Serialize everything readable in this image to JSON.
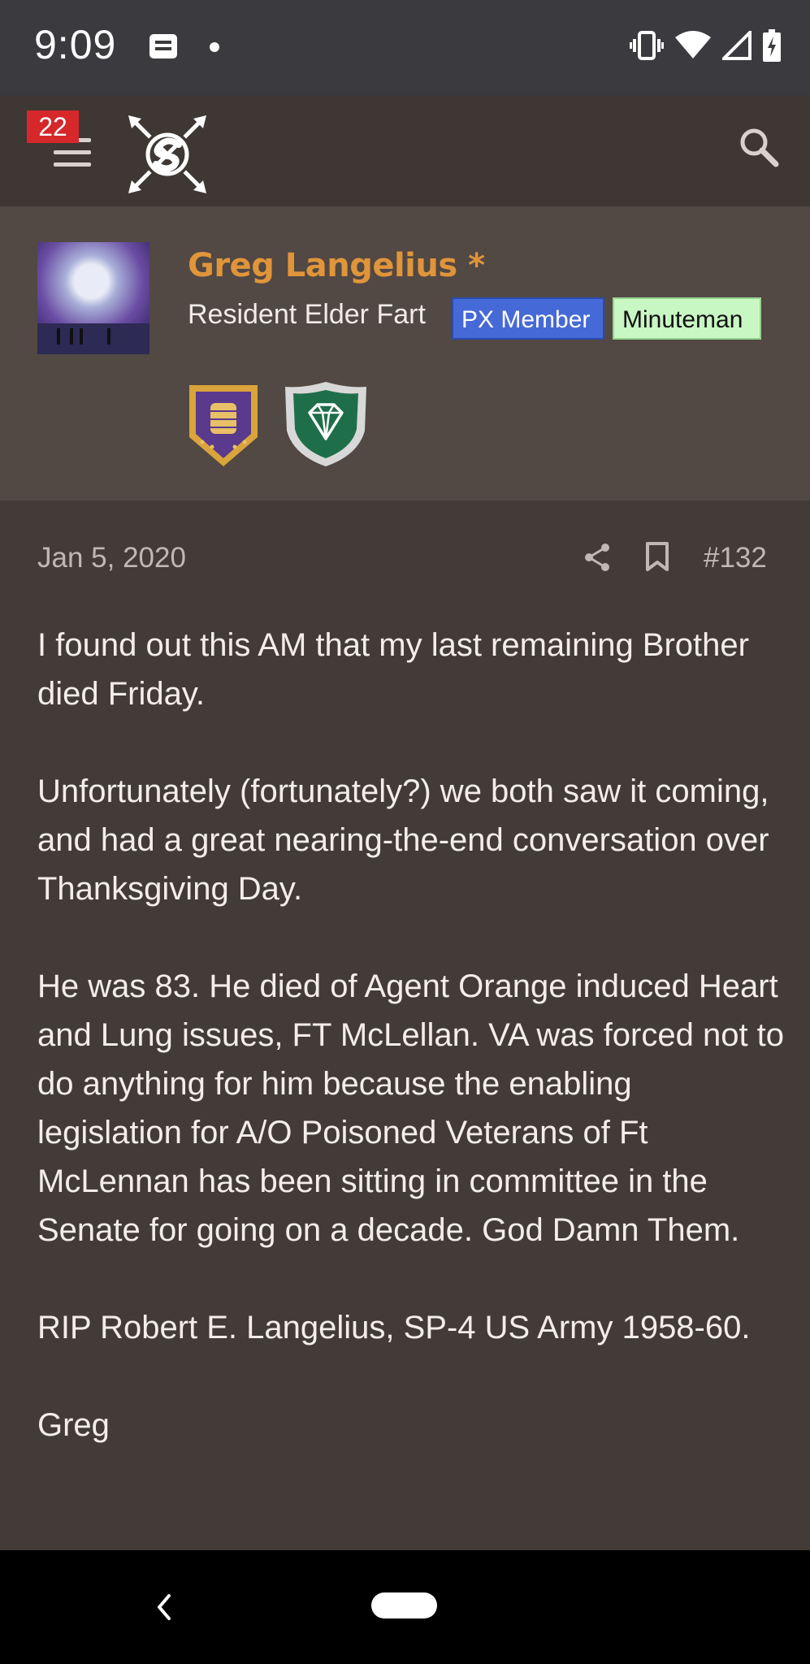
{
  "status_bar": {
    "time": "9:09",
    "icons": [
      "notification-icon",
      "dot",
      "vibrate-icon",
      "wifi-icon",
      "signal-icon",
      "battery-charging-icon"
    ]
  },
  "app_bar": {
    "notification_count": "22",
    "icons": [
      "hamburger-menu-icon",
      "site-logo",
      "search-icon"
    ]
  },
  "profile": {
    "username": "Greg Langelius *",
    "title": "Resident Elder Fart",
    "banners": [
      {
        "label": "PX Member",
        "color": "#4569d6"
      },
      {
        "label": "Minuteman",
        "color": "#c9f7c4"
      }
    ],
    "trophies": [
      "shield-vest-badge-icon",
      "diamond-shield-badge-icon"
    ]
  },
  "post": {
    "date": "Jan 5, 2020",
    "number": "#132",
    "paragraphs": [
      "I found out this AM that my last remaining Brother died Friday.",
      "Unfortunately (fortunately?) we both saw it coming, and had a great nearing-the-end conversation over Thanksgiving Day.",
      "He was 83. He died of Agent Orange induced Heart and Lung issues, FT McLellan. VA was forced not to do anything for him because the enabling legislation for A/O Poisoned Veterans of Ft McLennan has been sitting in committee in the Senate for going on a decade. God Damn Them.",
      "RIP Robert E. Langelius, SP-4 US Army 1958-60.",
      "Greg"
    ]
  },
  "colors": {
    "background": "#433b37",
    "profile_background": "#524844",
    "username": "#e0953a",
    "badge": "#d6272b"
  }
}
